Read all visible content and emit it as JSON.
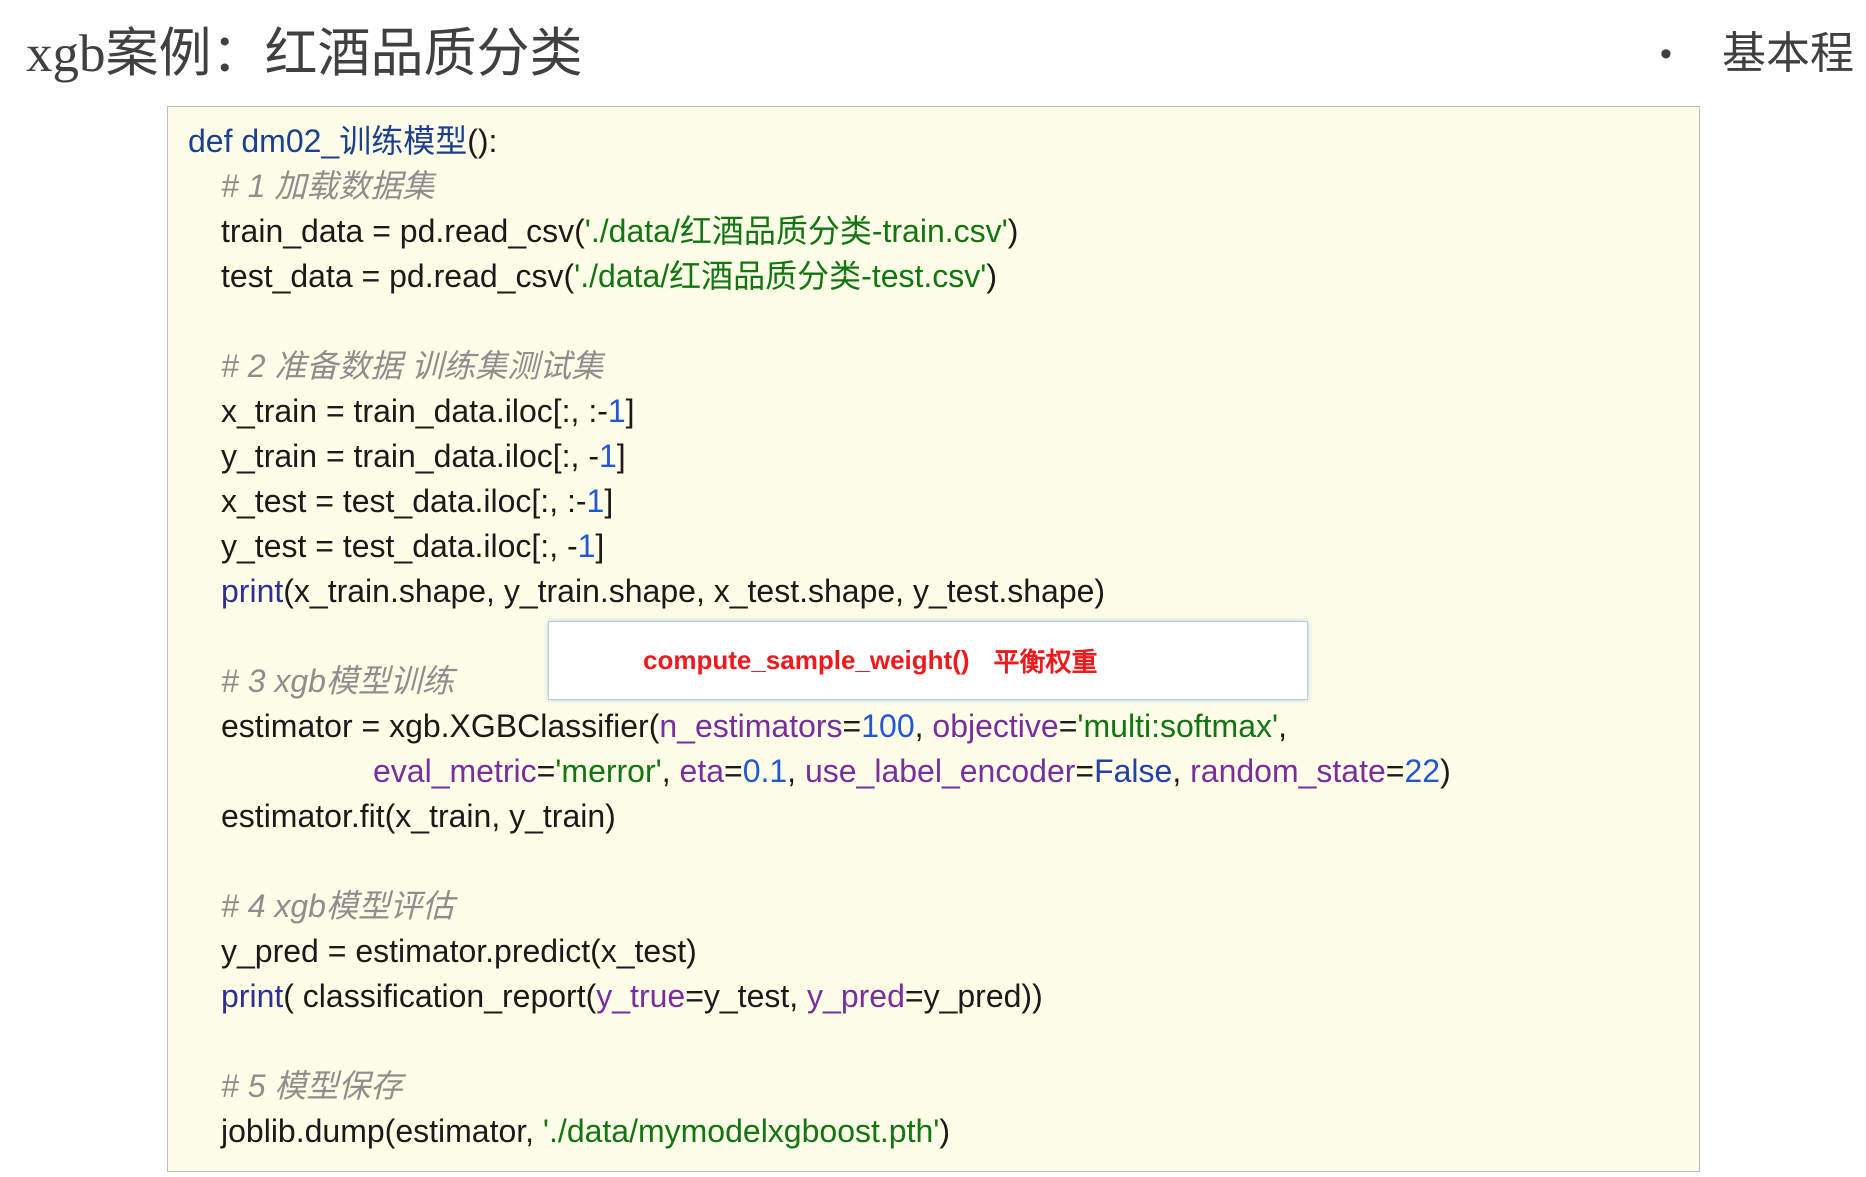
{
  "title": "xgb案例：红酒品质分类",
  "outline": {
    "bullet": "•",
    "text": "基本程"
  },
  "code": {
    "signature": [
      "def dm02_训练模型",
      "():"
    ],
    "sections": [
      {
        "comment": "# 1 加载数据集",
        "lines": [
          [
            "train_data = pd.read_csv(",
            "'./data/红酒品质分类-train.csv'",
            ")"
          ],
          [
            "test_data = pd.read_csv(",
            "'./data/红酒品质分类-test.csv'",
            ")"
          ]
        ]
      },
      {
        "comment": "# 2 准备数据 训练集测试集",
        "lines": [
          [
            "x_train = train_data.iloc[:, :-",
            "1",
            "]"
          ],
          [
            "y_train = train_data.iloc[:, -",
            "1",
            "]"
          ],
          [
            "x_test = test_data.iloc[:, :-",
            "1",
            "]"
          ],
          [
            "y_test = test_data.iloc[:, -",
            "1",
            "]"
          ],
          [
            "print",
            "(x_train.shape, y_train.shape, x_test.shape, y_test.shape)"
          ]
        ]
      },
      {
        "comment": "# 3 xgb模型训练",
        "lines": [
          [
            "estimator = xgb.XGBClassifier(",
            "n_estimators",
            "=",
            "100",
            ", ",
            "objective",
            "=",
            "'multi:softmax'",
            ","
          ],
          [
            "eval_metric",
            "=",
            "'merror'",
            ", ",
            "eta",
            "=",
            "0.1",
            ", ",
            "use_label_encoder",
            "=",
            "False",
            ", ",
            "random_state",
            "=",
            "22",
            ")"
          ],
          [
            "estimator.fit(x_train, y_train)"
          ]
        ]
      },
      {
        "comment": "# 4 xgb模型评估",
        "lines": [
          [
            "y_pred = estimator.predict(x_test)"
          ],
          [
            "print",
            "( classification_report(",
            "y_true",
            "=y_test, ",
            "y_pred",
            "=y_pred))"
          ]
        ]
      },
      {
        "comment": "# 5 模型保存",
        "lines": [
          [
            "joblib.dump(estimator, ",
            "'./data/mymodelxgboost.pth'",
            ")"
          ]
        ]
      }
    ]
  },
  "callout": {
    "function": "compute_sample_weight()",
    "note": "平衡权重"
  },
  "colors": {
    "title": "#404040",
    "code_background": "#fefee8",
    "code_border": "#bdbdbd",
    "plain": "#1a1a1a",
    "signature": "#1c3f8f",
    "comment": "#8e8e8e",
    "string": "#127512",
    "number": "#2257d4",
    "builtin": "#2f2f96",
    "kwarg": "#7a2d9c",
    "constant": "#2240a8",
    "callout_text": "#f0191c",
    "callout_border": "#b3cbe4"
  }
}
